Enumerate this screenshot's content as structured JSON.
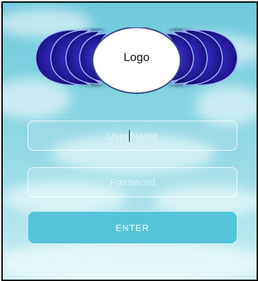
{
  "logo": {
    "label": "Logo"
  },
  "username": {
    "placeholder_before_cursor": "User ",
    "placeholder_after_cursor": "Name"
  },
  "password": {
    "placeholder": "Password"
  },
  "enter_button": {
    "label": "ENTER"
  },
  "colors": {
    "sky": "#7fd0de",
    "wing_fill": "#2a1fa8",
    "wing_dark": "#15105e",
    "button": "#55c4d8"
  },
  "icons": {
    "logo_wings": "crescent-wings-icon"
  }
}
